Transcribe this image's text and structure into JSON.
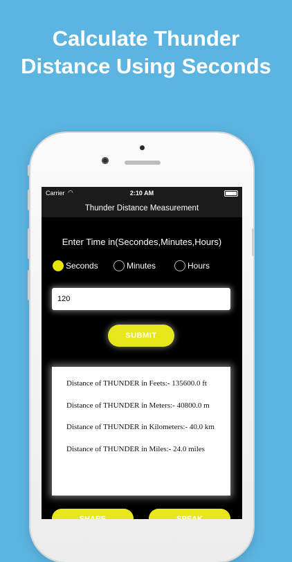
{
  "headline": {
    "line1": "Calculate Thunder",
    "line2": "Distance Using Seconds"
  },
  "status_bar": {
    "carrier": "Carrier",
    "time": "2:10 AM"
  },
  "navbar": {
    "title": "Thunder Distance Measurement"
  },
  "form": {
    "prompt": "Enter Time in(Secondes,Minutes,Hours)",
    "options": [
      "Seconds",
      "Minutes",
      "Hours"
    ],
    "selected": "Seconds",
    "time_value": "120",
    "submit_label": "SUBMIT"
  },
  "results": {
    "feet": "Distance of THUNDER in Feets:- 135600.0 ft",
    "meters": "Distance of THUNDER in Meters:- 40800.0 m",
    "kilometers": "Distance of THUNDER in Kilometers:- 40.0 km",
    "miles": "Distance of THUNDER in Miles:- 24.0 miles"
  },
  "actions": {
    "share_label": "SHARE",
    "speak_label": "SPEAK"
  },
  "colors": {
    "background": "#5cb5e1",
    "accent_yellow": "#e6e61a",
    "screen_bg": "#000000"
  }
}
